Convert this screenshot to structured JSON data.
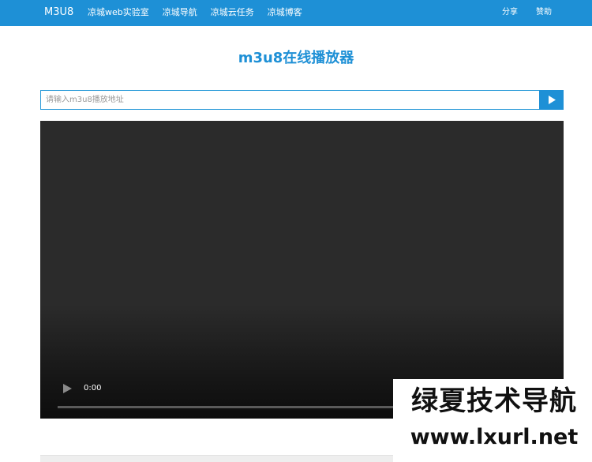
{
  "navbar": {
    "brand": "M3U8",
    "links": [
      "凉城web实验室",
      "凉城导航",
      "凉城云任务",
      "凉城博客"
    ],
    "right_links": [
      "分享",
      "赞助"
    ],
    "color": "#1e90d6"
  },
  "main": {
    "title": "m3u8在线播放器",
    "search": {
      "placeholder": "请输入m3u8播放地址",
      "value": "",
      "button_icon": "play-icon"
    }
  },
  "player": {
    "time": "0:00",
    "progress": 0,
    "play_icon": "play-icon"
  },
  "watermark": {
    "line1": "绿夏技术导航",
    "line2": "www.lxurl.net"
  }
}
